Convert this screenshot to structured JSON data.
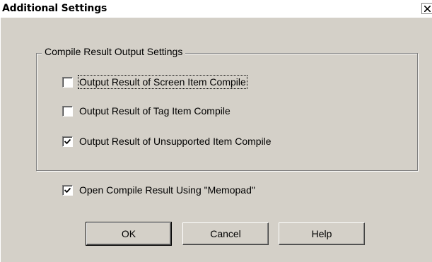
{
  "window": {
    "title": "Additional Settings",
    "close_glyph": "✕"
  },
  "group": {
    "label": "Compile Result Output Settings",
    "options": [
      {
        "label": "Output Result of Screen Item Compile",
        "checked": false,
        "focused": true
      },
      {
        "label": "Output Result of Tag Item Compile",
        "checked": false,
        "focused": false
      },
      {
        "label": "Output Result of Unsupported Item Compile",
        "checked": true,
        "focused": false
      }
    ]
  },
  "memopad_option": {
    "label": "Open Compile Result Using \"Memopad\"",
    "checked": true
  },
  "buttons": {
    "ok": "OK",
    "cancel": "Cancel",
    "help": "Help"
  },
  "colors": {
    "face": "#d4d0c8",
    "shadow": "#808080",
    "highlight": "#ffffff"
  }
}
